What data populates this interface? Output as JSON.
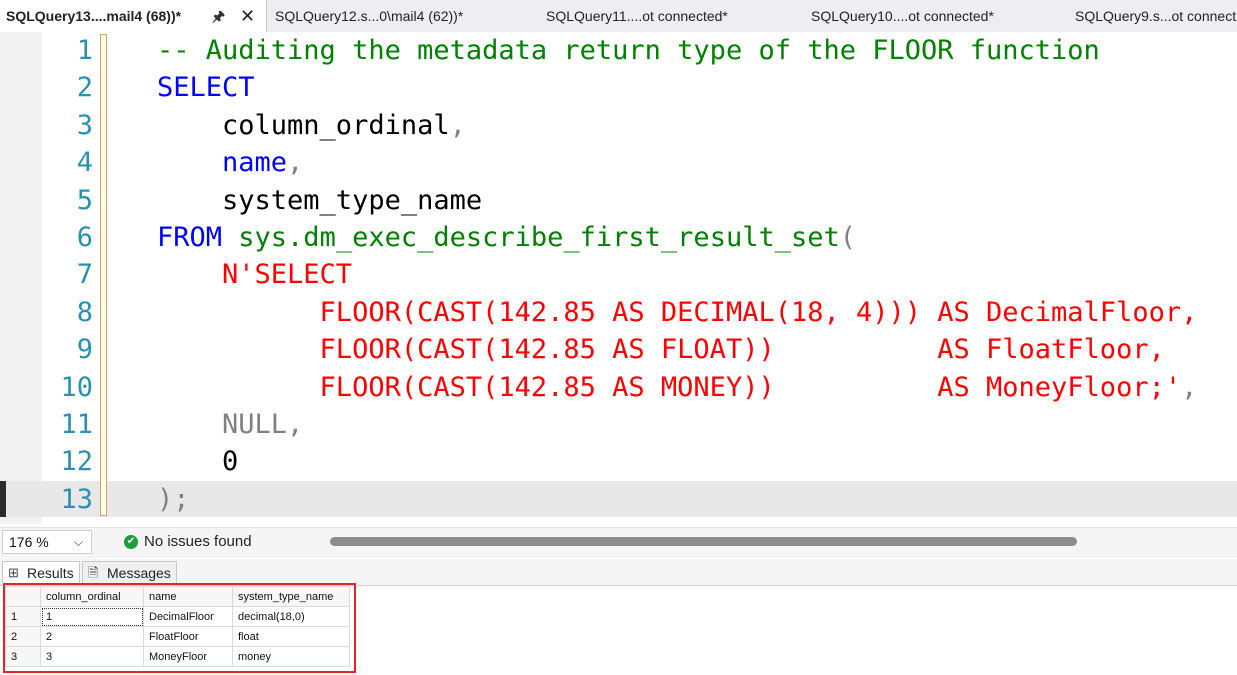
{
  "tabs": [
    {
      "label": "SQLQuery13....mail4 (68))*",
      "active": true
    },
    {
      "label": "SQLQuery12.s...0\\mail4 (62))*",
      "active": false
    },
    {
      "label": "SQLQuery11....ot connected*",
      "active": false
    },
    {
      "label": "SQLQuery10....ot connected*",
      "active": false
    },
    {
      "label": "SQLQuery9.s...ot connect",
      "active": false
    }
  ],
  "editor": {
    "current_line": 13,
    "lines": [
      {
        "n": "1",
        "tokens": [
          {
            "t": "-- Auditing the metadata return type of the FLOOR function",
            "c": "comment"
          }
        ]
      },
      {
        "n": "2",
        "tokens": [
          {
            "t": "SELECT",
            "c": "kw"
          }
        ]
      },
      {
        "n": "3",
        "tokens": [
          {
            "t": "    column_ordinal",
            "c": "id"
          },
          {
            "t": ",",
            "c": "gray"
          }
        ]
      },
      {
        "n": "4",
        "tokens": [
          {
            "t": "    name",
            "c": "kw"
          },
          {
            "t": ",",
            "c": "gray"
          }
        ]
      },
      {
        "n": "5",
        "tokens": [
          {
            "t": "    system_type_name",
            "c": "id"
          }
        ]
      },
      {
        "n": "6",
        "tokens": [
          {
            "t": "FROM",
            "c": "kw"
          },
          {
            "t": " sys.dm_exec_describe_first_result_set",
            "c": "sys"
          },
          {
            "t": "(",
            "c": "gray"
          }
        ]
      },
      {
        "n": "7",
        "tokens": [
          {
            "t": "    N'SELECT",
            "c": "str"
          }
        ]
      },
      {
        "n": "8",
        "tokens": [
          {
            "t": "          FLOOR(CAST(142.85 AS DECIMAL(18, 4))) AS DecimalFloor,",
            "c": "str"
          }
        ]
      },
      {
        "n": "9",
        "tokens": [
          {
            "t": "          FLOOR(CAST(142.85 AS FLOAT))          AS FloatFloor,",
            "c": "str"
          }
        ]
      },
      {
        "n": "10",
        "tokens": [
          {
            "t": "          FLOOR(CAST(142.85 AS MONEY))          AS MoneyFloor;'",
            "c": "str"
          },
          {
            "t": ",",
            "c": "gray"
          }
        ]
      },
      {
        "n": "11",
        "tokens": [
          {
            "t": "    NULL",
            "c": "gray"
          },
          {
            "t": ",",
            "c": "gray"
          }
        ]
      },
      {
        "n": "12",
        "tokens": [
          {
            "t": "    0",
            "c": "num"
          }
        ]
      },
      {
        "n": "13",
        "tokens": [
          {
            "t": ");",
            "c": "gray"
          }
        ]
      }
    ]
  },
  "status": {
    "zoom": "176 %",
    "issues": "No issues found"
  },
  "results_tabs": {
    "results": "Results",
    "messages": "Messages"
  },
  "grid": {
    "columns": [
      "column_ordinal",
      "name",
      "system_type_name"
    ],
    "rows": [
      {
        "rownum": "1",
        "cells": [
          "1",
          "DecimalFloor",
          "decimal(18,0)"
        ]
      },
      {
        "rownum": "2",
        "cells": [
          "2",
          "FloatFloor",
          "float"
        ]
      },
      {
        "rownum": "3",
        "cells": [
          "3",
          "MoneyFloor",
          "money"
        ]
      }
    ]
  },
  "colors": {
    "comment": "#008000",
    "keyword": "#0000ff",
    "string": "#ff0000",
    "line_number": "#2b91af",
    "highlight_box": "#e0262a",
    "ok_status": "#1f9c3b"
  }
}
